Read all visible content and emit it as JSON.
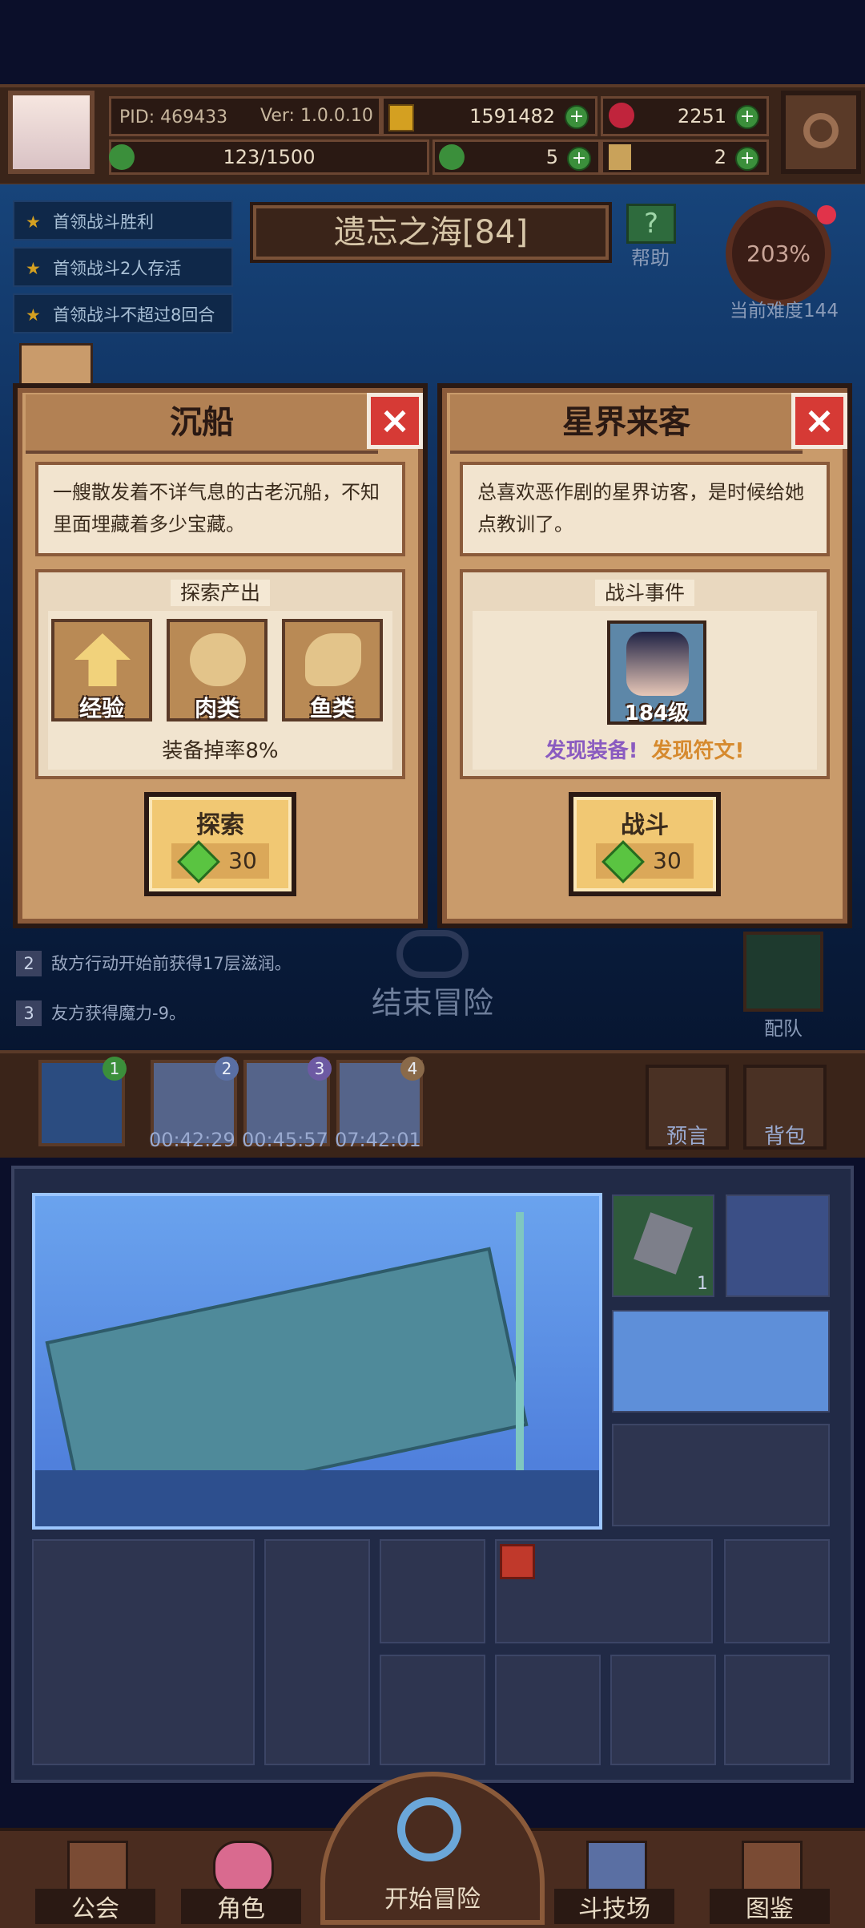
{
  "hud": {
    "pid": "PID: 469433",
    "version": "Ver: 1.0.0.10",
    "gold": "1591482",
    "gems": "2251",
    "stamina": "123/1500",
    "clover": "5",
    "keys": "2"
  },
  "quests": [
    "首领战斗胜利",
    "首领战斗2人存活",
    "首领战斗不超过8回合"
  ],
  "stage": {
    "title": "遗忘之海[84]",
    "help_label": "帮助",
    "difficulty_percent": "203%",
    "difficulty_label": "当前难度144"
  },
  "left_panel": {
    "title": "沉船",
    "description": "一艘散发着不详气息的古老沉船，不知里面埋藏着多少宝藏。",
    "section_label": "探索产出",
    "rewards": [
      {
        "label": "经验",
        "icon": "chevron-up-icon"
      },
      {
        "label": "肉类",
        "icon": "meat-icon"
      },
      {
        "label": "鱼类",
        "icon": "fish-icon"
      }
    ],
    "drop_rate": "装备掉率8%",
    "action_label": "探索",
    "cost": "30"
  },
  "right_panel": {
    "title": "星界来客",
    "description": "总喜欢恶作剧的星界访客，是时候给她点教训了。",
    "section_label": "战斗事件",
    "enemy_level": "184级",
    "find_equipment": "发现装备!",
    "find_rune": "发现符文!",
    "action_label": "战斗",
    "cost": "30"
  },
  "logs": [
    {
      "num": "2",
      "text": "敌方行动开始前获得17层滋润。"
    },
    {
      "num": "3",
      "text": "友方获得魔力-9。"
    }
  ],
  "end_adventure": "结束冒险",
  "team_label": "配队",
  "slots": [
    {
      "num": "1",
      "timer": ""
    },
    {
      "num": "2",
      "timer": "00:42:29"
    },
    {
      "num": "3",
      "timer": "00:45:57"
    },
    {
      "num": "4",
      "timer": "07:42:01"
    }
  ],
  "side_buttons": {
    "prophecy": "预言",
    "bag": "背包"
  },
  "inventory_count": "1",
  "nav": {
    "guild": "公会",
    "character": "角色",
    "start_adventure": "开始冒险",
    "arena": "斗技场",
    "codex": "图鉴"
  },
  "colors": {
    "accent_gold": "#f1c873",
    "close_red": "#d63a35",
    "gem_green": "#5ac441",
    "equip_purple": "#8a5bc0",
    "rune_orange": "#d68a2e"
  }
}
